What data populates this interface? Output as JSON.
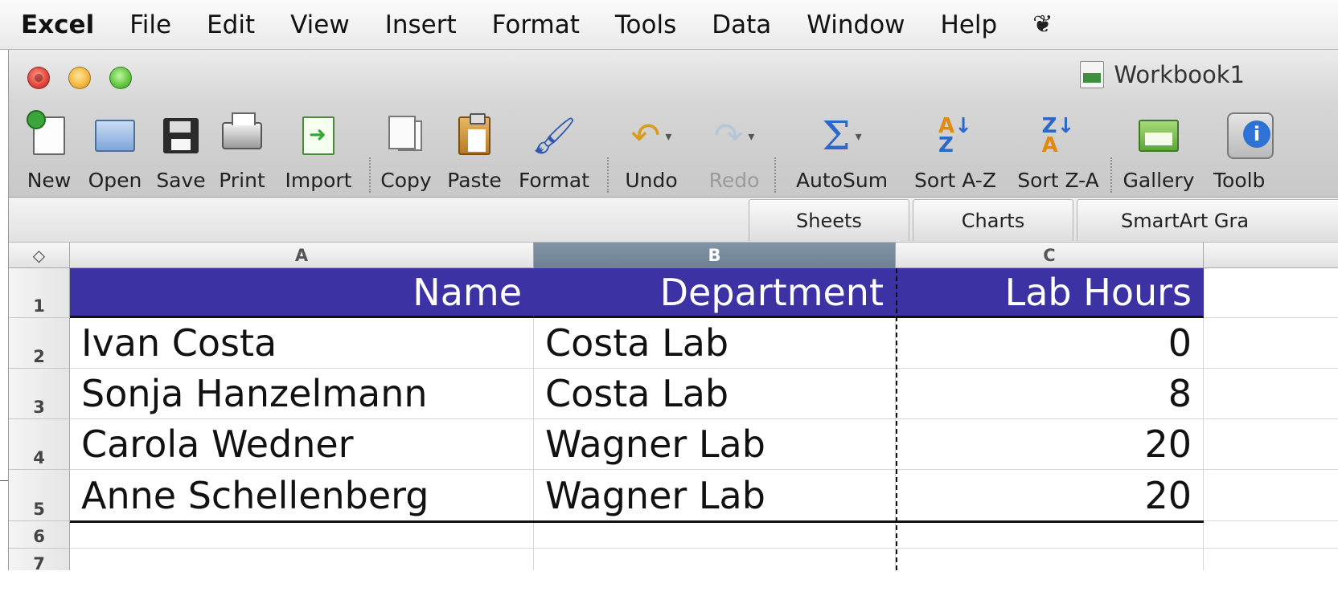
{
  "menubar": {
    "app": "Excel",
    "items": [
      "File",
      "Edit",
      "View",
      "Insert",
      "Format",
      "Tools",
      "Data",
      "Window",
      "Help"
    ],
    "script_icon": "script-menu-icon"
  },
  "window": {
    "title": "Workbook1"
  },
  "toolbar": {
    "new": "New",
    "open": "Open",
    "save": "Save",
    "print": "Print",
    "import": "Import",
    "copy": "Copy",
    "paste": "Paste",
    "format": "Format",
    "undo": "Undo",
    "redo": "Redo",
    "autosum": "AutoSum",
    "sort_az": "Sort A-Z",
    "sort_za": "Sort Z-A",
    "gallery": "Gallery",
    "toolbox": "Toolb"
  },
  "ribbon": {
    "tabs": [
      "Sheets",
      "Charts",
      "SmartArt Gra"
    ]
  },
  "sheet": {
    "columns": [
      "A",
      "B",
      "C"
    ],
    "selected_column": "B",
    "row_numbers": [
      "1",
      "2",
      "3",
      "4",
      "5",
      "6",
      "7"
    ],
    "header": [
      "Name",
      "Department",
      "Lab Hours"
    ],
    "rows": [
      [
        "Ivan Costa",
        "Costa Lab",
        "0"
      ],
      [
        "Sonja Hanzelmann",
        "Costa Lab",
        "8"
      ],
      [
        "Carola Wedner",
        "Wagner Lab",
        "20"
      ],
      [
        "Anne Schellenberg",
        "Wagner Lab",
        "20"
      ]
    ],
    "header_fill": "#3d32a3"
  }
}
